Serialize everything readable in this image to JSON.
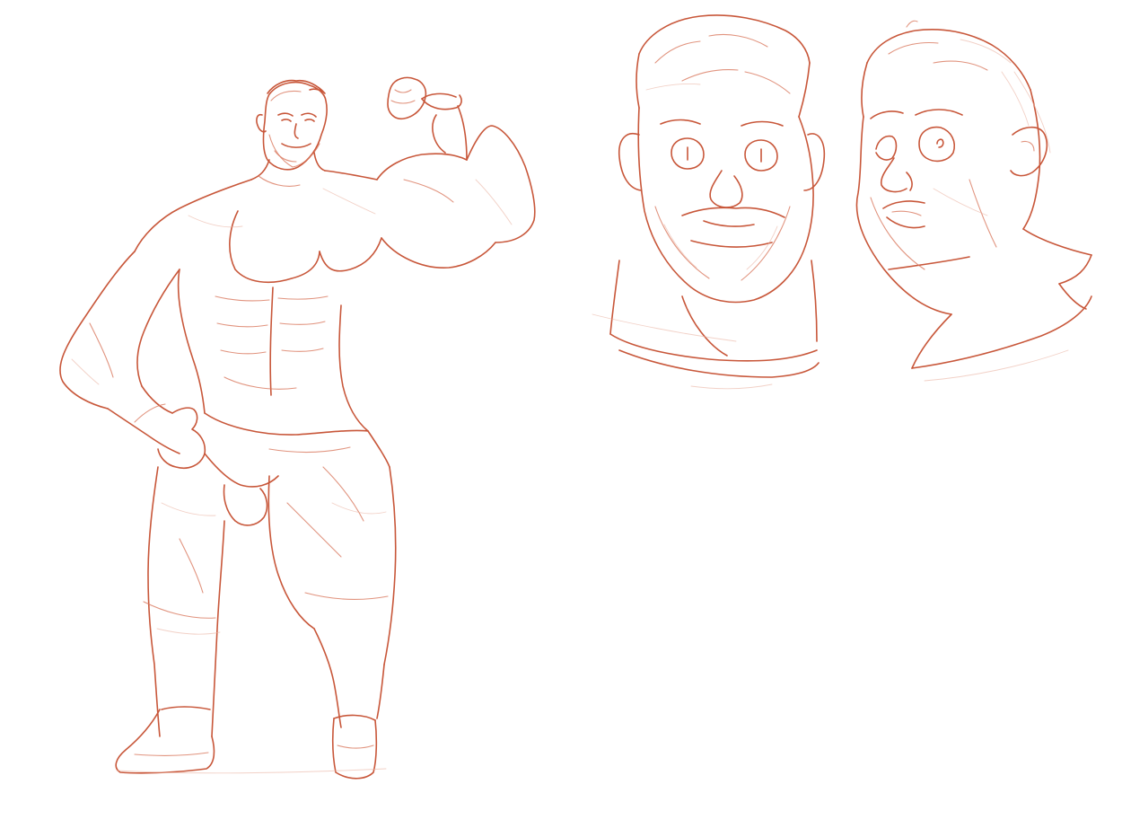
{
  "colors": {
    "background": "#ffffff",
    "ink": "#c8573a",
    "ink_light": "#d9795f",
    "ink_faint": "#eab3a2"
  },
  "figures": [
    {
      "name": "full-body-flexing-pose"
    },
    {
      "name": "head-front-view"
    },
    {
      "name": "head-three-quarter-view"
    }
  ]
}
